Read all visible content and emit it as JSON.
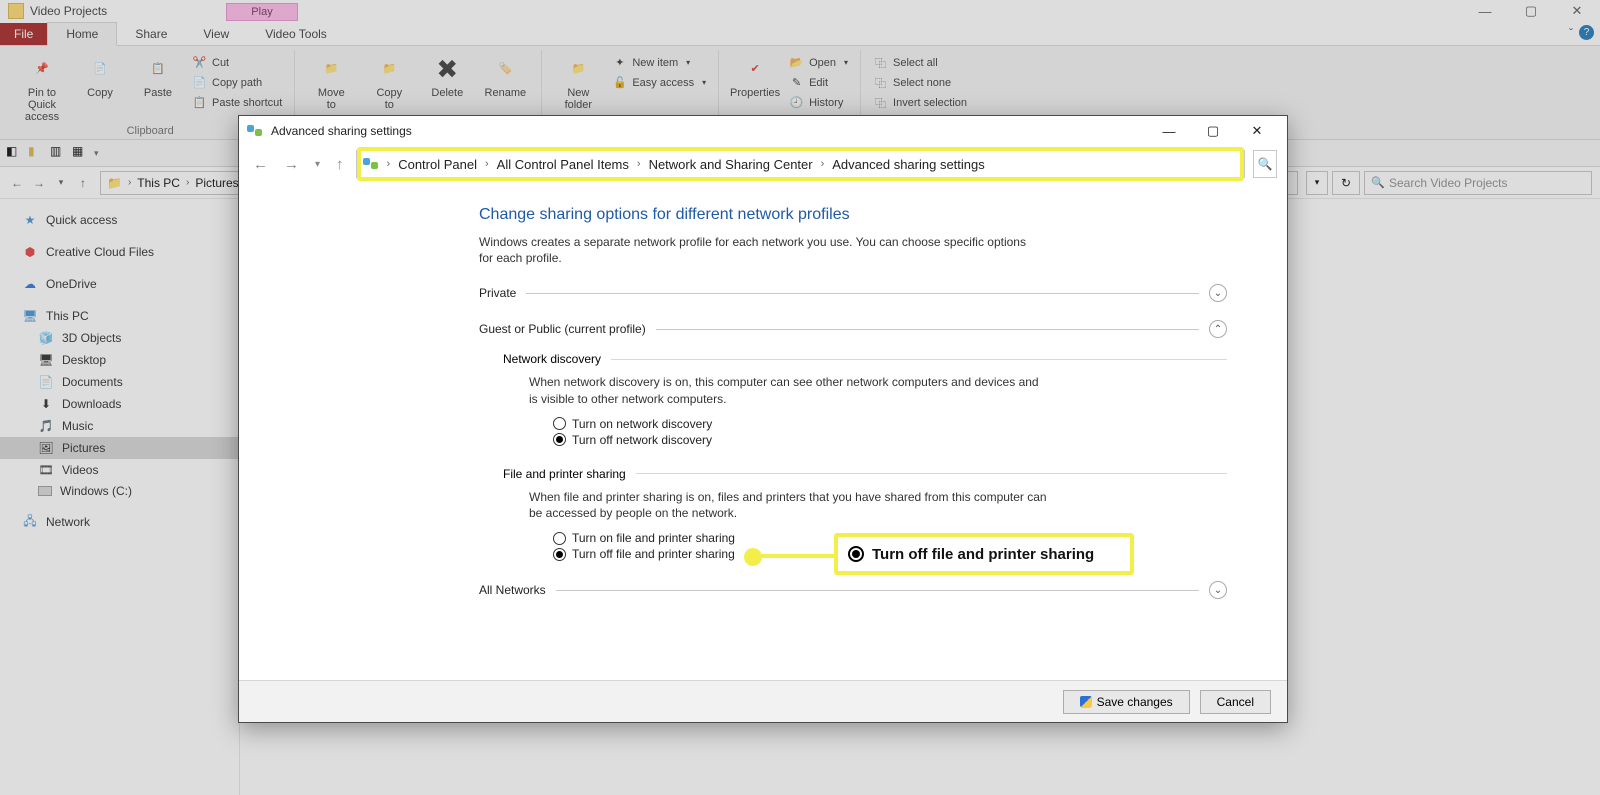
{
  "explorer": {
    "title": "Video Projects",
    "play_tab": "Play",
    "tabs": {
      "file": "File",
      "home": "Home",
      "share": "Share",
      "view": "View",
      "video_tools": "Video Tools"
    },
    "ribbon": {
      "pin": "Pin to Quick\naccess",
      "copy": "Copy",
      "paste": "Paste",
      "cut": "Cut",
      "copy_path": "Copy path",
      "paste_shortcut": "Paste shortcut",
      "clipboard": "Clipboard",
      "move_to": "Move\nto",
      "copy_to": "Copy\nto",
      "delete": "Delete",
      "rename": "Rename",
      "new_folder": "New\nfolder",
      "new_item": "New item",
      "easy_access": "Easy access",
      "properties": "Properties",
      "open": "Open",
      "edit": "Edit",
      "history": "History",
      "select_all": "Select all",
      "select_none": "Select none",
      "invert": "Invert selection"
    },
    "addr_parts": [
      "This PC",
      "Pictures"
    ],
    "search_placeholder": "Search Video Projects",
    "sidebar": {
      "quick": "Quick access",
      "cc": "Creative Cloud Files",
      "onedrive": "OneDrive",
      "thispc": "This PC",
      "obj3d": "3D Objects",
      "desktop": "Desktop",
      "documents": "Documents",
      "downloads": "Downloads",
      "music": "Music",
      "pictures": "Pictures",
      "videos": "Videos",
      "drive_c": "Windows (C:)",
      "network": "Network"
    }
  },
  "modal": {
    "title": "Advanced sharing settings",
    "crumbs": [
      "Control Panel",
      "All Control Panel Items",
      "Network and Sharing Center",
      "Advanced sharing settings"
    ],
    "heading": "Change sharing options for different network profiles",
    "desc": "Windows creates a separate network profile for each network you use. You can choose specific options for each profile.",
    "private": "Private",
    "guest": "Guest or Public (current profile)",
    "netdisc": {
      "head": "Network discovery",
      "desc": "When network discovery is on, this computer can see other network computers and devices and is visible to other network computers.",
      "on": "Turn on network discovery",
      "off": "Turn off network discovery"
    },
    "fileshare": {
      "head": "File and printer sharing",
      "desc": "When file and printer sharing is on, files and printers that you have shared from this computer can be accessed by people on the network.",
      "on": "Turn on file and printer sharing",
      "off": "Turn off file and printer sharing"
    },
    "allnet": "All Networks",
    "save": "Save changes",
    "cancel": "Cancel"
  },
  "callout": {
    "text": "Turn off file and printer sharing"
  }
}
